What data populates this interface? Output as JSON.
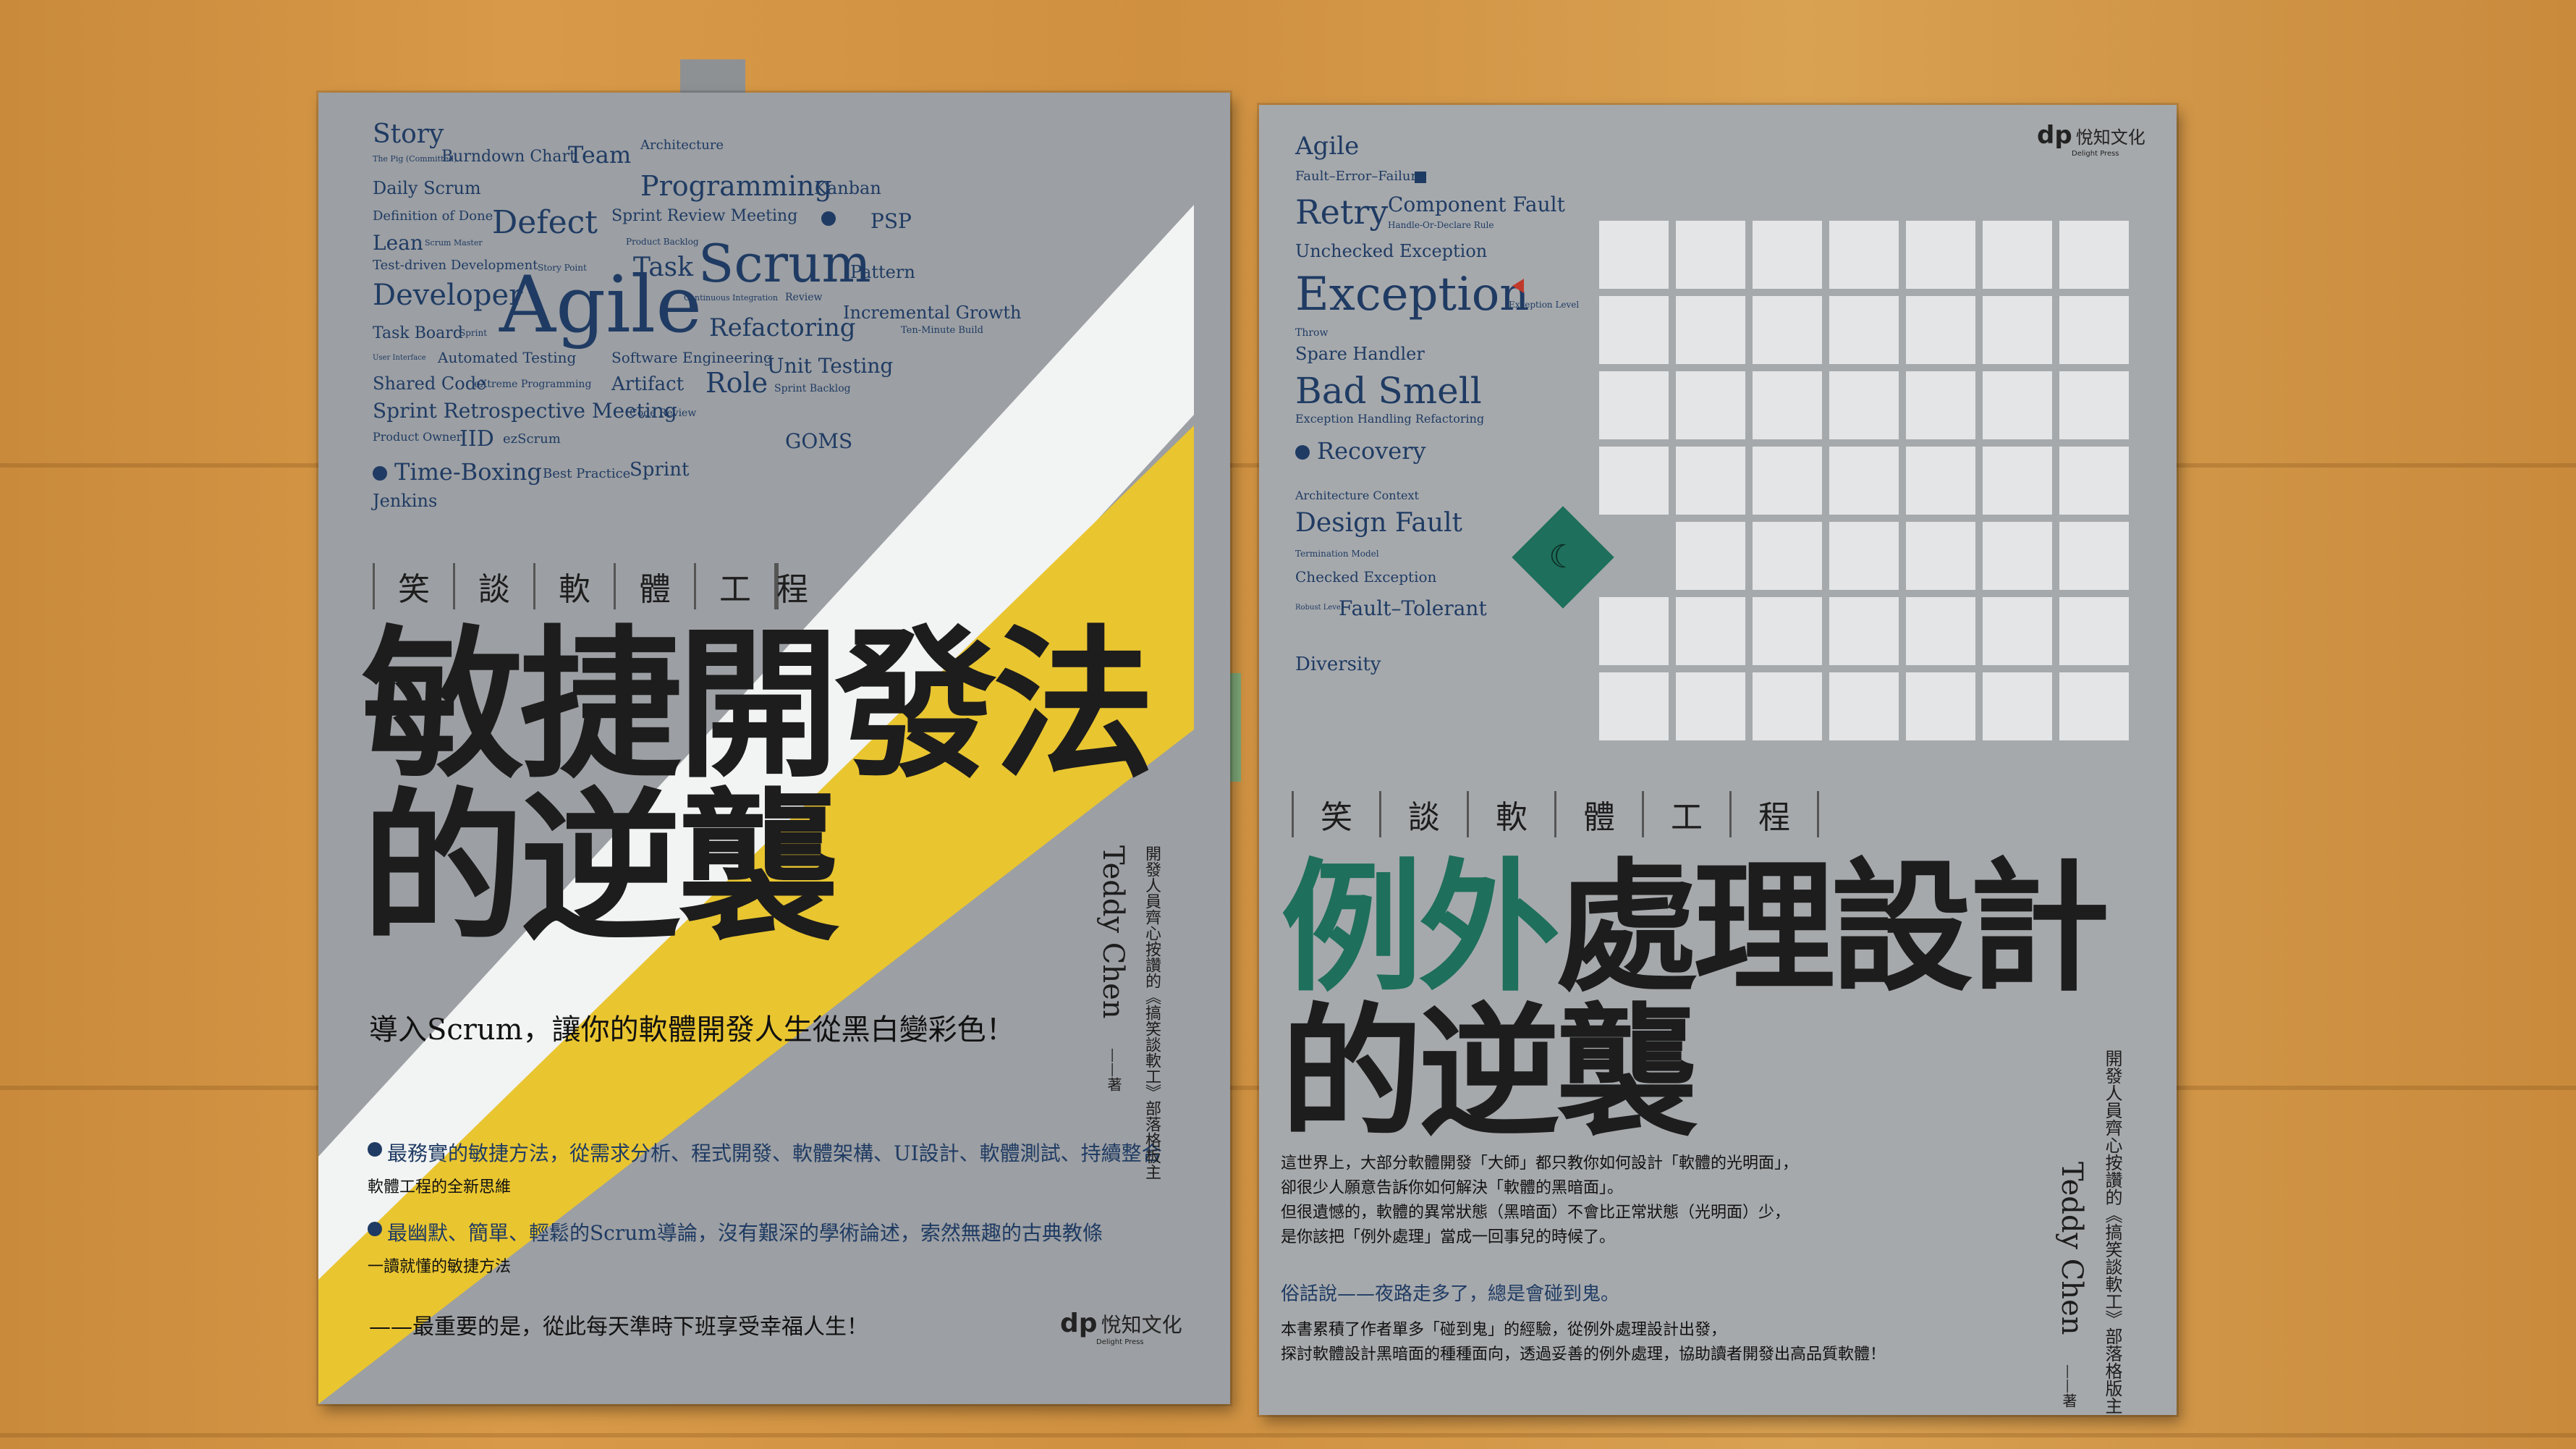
{
  "book1": {
    "word_cloud": [
      {
        "id": "story",
        "text": "Story"
      },
      {
        "id": "pig",
        "text": "The Pig (Committed)"
      },
      {
        "id": "burndown",
        "text": "Burndown Chart"
      },
      {
        "id": "team",
        "text": "Team"
      },
      {
        "id": "architecture",
        "text": "Architecture"
      },
      {
        "id": "daily_scrum",
        "text": "Daily Scrum"
      },
      {
        "id": "programming",
        "text": "Programming"
      },
      {
        "id": "kanban",
        "text": "Kanban"
      },
      {
        "id": "dod",
        "text": "Definition of Done"
      },
      {
        "id": "defect",
        "text": "Defect"
      },
      {
        "id": "sprint_review",
        "text": "Sprint Review Meeting"
      },
      {
        "id": "psp",
        "text": "PSP"
      },
      {
        "id": "lean",
        "text": "Lean"
      },
      {
        "id": "scrum_master",
        "text": "Scrum Master"
      },
      {
        "id": "product_backlog",
        "text": "Product Backlog"
      },
      {
        "id": "tdd",
        "text": "Test-driven Development"
      },
      {
        "id": "story_point",
        "text": "Story Point"
      },
      {
        "id": "task",
        "text": "Task"
      },
      {
        "id": "scrum",
        "text": "Scrum"
      },
      {
        "id": "pattern",
        "text": "Pattern"
      },
      {
        "id": "developer",
        "text": "Developer"
      },
      {
        "id": "agile",
        "text": "Agile"
      },
      {
        "id": "ci",
        "text": "Continuous Integration"
      },
      {
        "id": "review",
        "text": "Review"
      },
      {
        "id": "incremental",
        "text": "Incremental Growth"
      },
      {
        "id": "task_board",
        "text": "Task Board"
      },
      {
        "id": "sprint",
        "text": "Sprint"
      },
      {
        "id": "refactoring",
        "text": "Refactoring"
      },
      {
        "id": "ten_minute",
        "text": "Ten-Minute Build"
      },
      {
        "id": "user_interface",
        "text": "User Interface"
      },
      {
        "id": "automated_testing",
        "text": "Automated Testing"
      },
      {
        "id": "software_eng",
        "text": "Software Engineering"
      },
      {
        "id": "unit_testing",
        "text": "Unit Testing"
      },
      {
        "id": "shared_code",
        "text": "Shared Code"
      },
      {
        "id": "xp",
        "text": "eXtreme Programming"
      },
      {
        "id": "artifact",
        "text": "Artifact"
      },
      {
        "id": "role",
        "text": "Role"
      },
      {
        "id": "sprint_backlog",
        "text": "Sprint Backlog"
      },
      {
        "id": "retro",
        "text": "Sprint Retrospective Meeting"
      },
      {
        "id": "code_review",
        "text": "Code Review"
      },
      {
        "id": "product_owner",
        "text": "Product Owner"
      },
      {
        "id": "iid",
        "text": "IID"
      },
      {
        "id": "ezscrum",
        "text": "ezScrum"
      },
      {
        "id": "goms",
        "text": "GOMS"
      },
      {
        "id": "time_boxing",
        "text": "Time-Boxing"
      },
      {
        "id": "best_practice",
        "text": "Best Practice"
      },
      {
        "id": "sprint2",
        "text": "Sprint"
      },
      {
        "id": "jenkins",
        "text": "Jenkins"
      }
    ],
    "series_chars": [
      "笑",
      "談",
      "軟",
      "體",
      "工",
      "程"
    ],
    "title_line1": "敏捷開發法",
    "title_line2": "的逆襲",
    "subtitle": "導入Scrum，讓你的軟體開發人生從黑白變彩色！",
    "bullet1": "最務實的敏捷方法，從需求分析、程式開發、軟體架構、UI設計、軟體測試、持續整合",
    "bullet1_sub": "軟體工程的全新思維",
    "bullet2": "最幽默、簡單、輕鬆的Scrum導論，沒有艱深的學術論述，索然無趣的古典教條",
    "bullet2_sub": "一讀就懂的敏捷方法",
    "closing": "——最重要的是，從此每天準時下班享受幸福人生！",
    "author_tagline": "開發人員齊心按讚的《搞笑談軟工》部落格板主",
    "author_name": "Teddy Chen",
    "author_suffix": "——著",
    "publisher": "悅知文化",
    "publisher_en": "Delight Press",
    "publisher_mark": "dp"
  },
  "book2": {
    "word_list": [
      {
        "id": "agile",
        "text": "Agile"
      },
      {
        "id": "fef",
        "text": "Fault–Error–Failure"
      },
      {
        "id": "retry",
        "text": "Retry"
      },
      {
        "id": "component_fault",
        "text": "Component Fault"
      },
      {
        "id": "handle_declare",
        "text": "Handle-Or-Declare Rule"
      },
      {
        "id": "unchecked",
        "text": "Unchecked Exception"
      },
      {
        "id": "exception",
        "text": "Exception"
      },
      {
        "id": "exception_level",
        "text": "Exception Level"
      },
      {
        "id": "throw",
        "text": "Throw"
      },
      {
        "id": "spare_handler",
        "text": "Spare Handler"
      },
      {
        "id": "bad_smell",
        "text": "Bad Smell"
      },
      {
        "id": "eh_refactoring",
        "text": "Exception Handling Refactoring"
      },
      {
        "id": "recovery",
        "text": "Recovery"
      },
      {
        "id": "arch_context",
        "text": "Architecture Context"
      },
      {
        "id": "design_fault",
        "text": "Design Fault"
      },
      {
        "id": "termination",
        "text": "Termination Model"
      },
      {
        "id": "checked",
        "text": "Checked Exception"
      },
      {
        "id": "robust",
        "text": "Robust Level"
      },
      {
        "id": "fault_tolerant",
        "text": "Fault–Tolerant"
      },
      {
        "id": "diversity",
        "text": "Diversity"
      }
    ],
    "series_chars": [
      "笑",
      "談",
      "軟",
      "體",
      "工",
      "程"
    ],
    "title_line1_accent": "例外",
    "title_line1_rest": "處理設計",
    "title_line2": "的逆襲",
    "para1": [
      "這世界上，大部分軟體開發「大師」都只教你如何設計「軟體的光明面」，",
      "卻很少人願意告訴你如何解決「軟體的黑暗面」。",
      "但很遺憾的，軟體的異常狀態（黑暗面）不會比正常狀態（光明面）少，",
      "是你該把「例外處理」當成一回事兒的時候了。"
    ],
    "saying": "俗話說——夜路走多了，總是會碰到鬼。",
    "para2": [
      "本書累積了作者單多「碰到鬼」的經驗，從例外處理設計出發，",
      "探討軟體設計黑暗面的種種面向，透過妥善的例外處理，協助讀者開發出高品質軟體！"
    ],
    "author_tagline": "開發人員齊心按讚的《搞笑談軟工》部落格版主",
    "author_name": "Teddy Chen",
    "author_suffix": "——著",
    "publisher": "悅知文化",
    "publisher_en": "Delight Press",
    "publisher_mark": "dp"
  },
  "colors": {
    "wood": "#d39645",
    "cover1": "#9c9fa3",
    "cover2": "#a6a9ac",
    "accent_yellow": "#e9c530",
    "accent_white": "#f2f3f3",
    "accent_teal": "#1e6f5c",
    "navy_text": "#1f3b63"
  }
}
